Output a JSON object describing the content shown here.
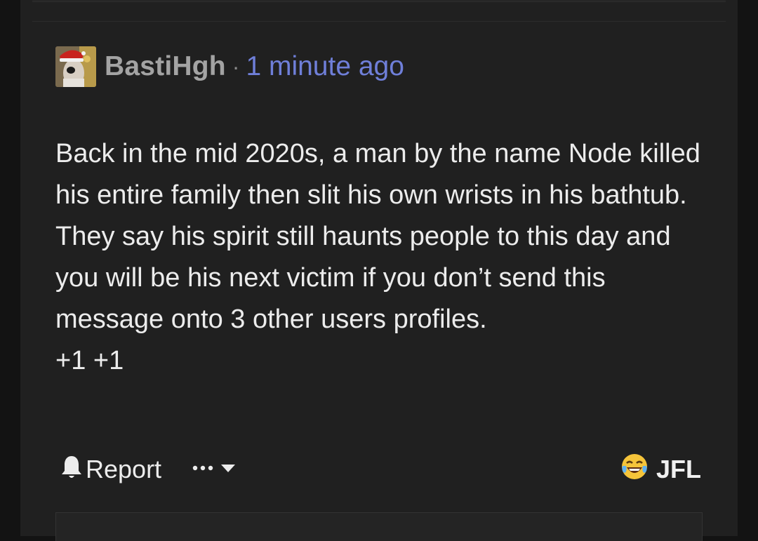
{
  "comment": {
    "username": "BastiHgh",
    "separator": "·",
    "timestamp": "1 minute ago",
    "body_lines": [
      "Back in the mid 2020s, a man by the name Node killed his entire family then slit his own wrists in his bathtub. They say his spirit still haunts people to this day and you will be his next victim if you don’t send this message onto 3 other users profiles.",
      "+1 +1"
    ]
  },
  "actions": {
    "report_label": "Report",
    "reaction_label": "JFL"
  },
  "colors": {
    "background": "#202020",
    "username": "#a3a3a3",
    "timestamp": "#6f7fd9",
    "text": "#ececec"
  },
  "icons": {
    "report": "bell-icon",
    "more": "ellipsis-icon",
    "dropdown": "caret-down-icon",
    "reaction": "crying-laughing-emoji-icon"
  }
}
